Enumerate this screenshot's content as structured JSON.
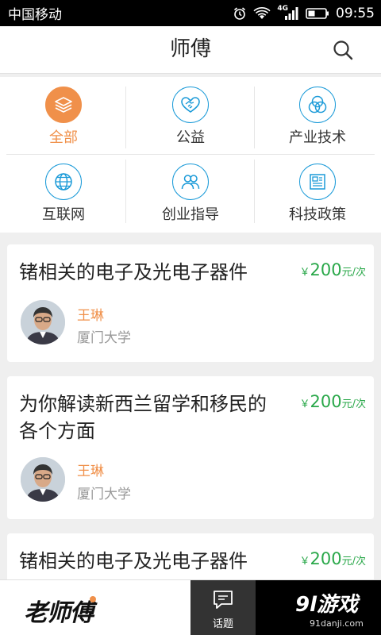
{
  "status_bar": {
    "carrier": "中国移动",
    "network": "4G",
    "time": "09:55"
  },
  "header": {
    "title": "师傅"
  },
  "categories": [
    {
      "label": "全部",
      "icon": "layers-icon",
      "active": true
    },
    {
      "label": "公益",
      "icon": "handshake-icon",
      "active": false
    },
    {
      "label": "产业技术",
      "icon": "overlap-circles-icon",
      "active": false
    },
    {
      "label": "互联网",
      "icon": "globe-icon",
      "active": false
    },
    {
      "label": "创业指导",
      "icon": "people-icon",
      "active": false
    },
    {
      "label": "科技政策",
      "icon": "newspaper-icon",
      "active": false
    }
  ],
  "cards": [
    {
      "title": "锗相关的电子及光电子器件",
      "price_symbol": "￥",
      "price": "200",
      "price_unit": "元/次",
      "mentor_name": "王琳",
      "mentor_school": "厦门大学"
    },
    {
      "title": "为你解读新西兰留学和移民的各个方面",
      "price_symbol": "￥",
      "price": "200",
      "price_unit": "元/次",
      "mentor_name": "王琳",
      "mentor_school": "厦门大学"
    },
    {
      "title": "锗相关的电子及光电子器件",
      "price_symbol": "￥",
      "price": "200",
      "price_unit": "元/次"
    }
  ],
  "bottom_bar": {
    "logo": "老师傅",
    "topic_label": "话题"
  },
  "watermark": {
    "brand": "9l游戏",
    "url": "91danji.com"
  },
  "colors": {
    "accent": "#f0904a",
    "icon_blue": "#1a9ad8",
    "price_green": "#2aa84a"
  }
}
